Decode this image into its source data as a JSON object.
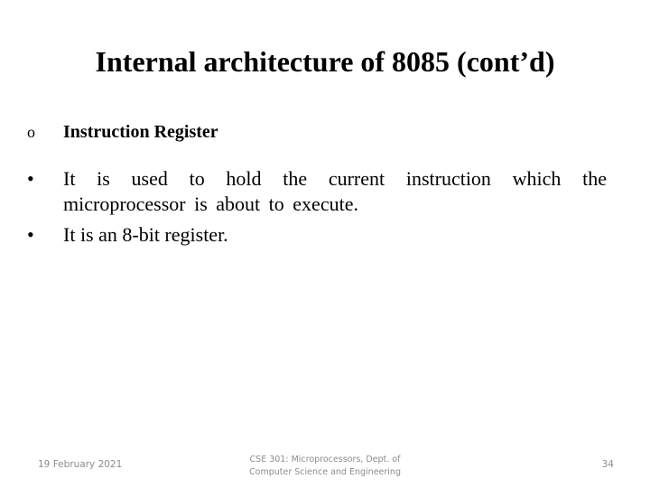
{
  "slide": {
    "title": "Internal architecture of 8085 (cont’d)",
    "subheading": {
      "marker": "o",
      "label": "Instruction Register"
    },
    "bullets": [
      {
        "symbol": "•",
        "text": "It is used to hold the current instruction which the microprocessor is about to execute."
      },
      {
        "symbol": "•",
        "text": "It is an 8-bit register."
      }
    ],
    "footer": {
      "date": "19 February 2021",
      "center_line1": "CSE 301: Microprocessors, Dept. of",
      "center_line2": "Computer Science and Engineering",
      "page_number": "34"
    }
  }
}
